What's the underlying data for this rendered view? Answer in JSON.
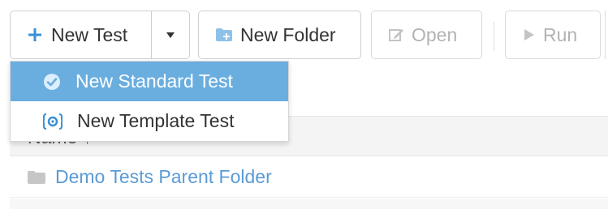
{
  "toolbar": {
    "new_test_label": "New Test",
    "new_folder_label": "New Folder",
    "open_label": "Open",
    "run_label": "Run"
  },
  "menu": {
    "items": [
      {
        "label": "New Standard Test",
        "icon": "check-circle-icon",
        "selected": true
      },
      {
        "label": "New Template Test",
        "icon": "template-gear-icon",
        "selected": false
      }
    ]
  },
  "table": {
    "header": "Name ↑",
    "rows": [
      {
        "label": "Demo Tests Parent Folder",
        "icon": "folder-icon"
      }
    ]
  },
  "colors": {
    "accent": "#6aaedf",
    "link": "#5b9bd5",
    "icon_blue": "#3a8fd6",
    "disabled": "#b3b3b3"
  }
}
